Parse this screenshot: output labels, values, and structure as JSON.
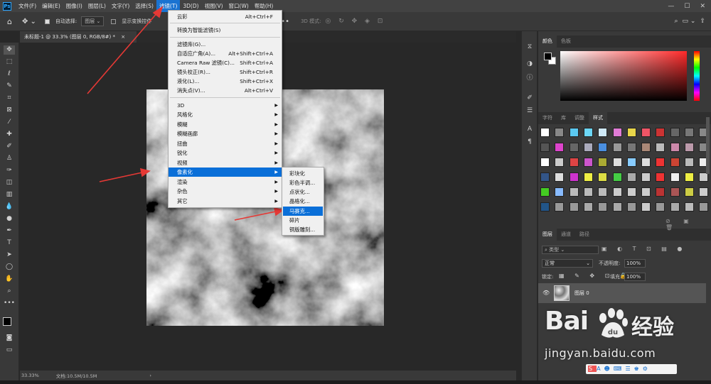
{
  "menubar": {
    "logo": "Ps",
    "items": [
      "文件(F)",
      "编辑(E)",
      "图像(I)",
      "图层(L)",
      "文字(Y)",
      "选择(S)",
      "滤镜(T)",
      "3D(D)",
      "视图(V)",
      "窗口(W)",
      "帮助(H)"
    ],
    "active_index": 6,
    "window_controls": [
      "—",
      "☐",
      "✕"
    ]
  },
  "options_bar": {
    "auto_select_label": "自动选择:",
    "auto_select_value": "图层",
    "show_transform_label": "显示变换控件",
    "mode_3d_label": "3D 模式:"
  },
  "document": {
    "tab_title": "未标题-1 @ 33.3% (图层 0, RGB/8#) *",
    "tab_close": "×"
  },
  "statusbar": {
    "zoom": "33.33%",
    "doc_info": "文档:10.5M/10.5M",
    "arrow": "›"
  },
  "filter_menu": {
    "top_items": [
      {
        "label": "云彩",
        "shortcut": "Alt+Ctrl+F"
      },
      {
        "label": "转换为智能滤镜(S)",
        "shortcut": ""
      },
      {
        "label": "滤镜库(G)...",
        "shortcut": ""
      },
      {
        "label": "自适应广角(A)...",
        "shortcut": "Alt+Shift+Ctrl+A"
      },
      {
        "label": "Camera Raw 滤镜(C)...",
        "shortcut": "Shift+Ctrl+A"
      },
      {
        "label": "镜头校正(R)...",
        "shortcut": "Shift+Ctrl+R"
      },
      {
        "label": "液化(L)...",
        "shortcut": "Shift+Ctrl+X"
      },
      {
        "label": "消失点(V)...",
        "shortcut": "Alt+Ctrl+V"
      }
    ],
    "submenus": [
      "3D",
      "风格化",
      "模糊",
      "模糊画廊",
      "扭曲",
      "锐化",
      "视频",
      "像素化",
      "渲染",
      "杂色",
      "其它"
    ],
    "highlighted_submenu": "像素化"
  },
  "pixelate_menu": {
    "items": [
      "彩块化",
      "彩色半调...",
      "点状化...",
      "晶格化...",
      "马赛克...",
      "碎片",
      "铜版雕刻..."
    ],
    "highlighted": "马赛克..."
  },
  "panels": {
    "color_tabs": [
      "颜色",
      "色板"
    ],
    "style_tabs": [
      "字符",
      "库",
      "调整",
      "样式"
    ],
    "active_style_tab": "样式",
    "layers_tabs": [
      "图层",
      "通道",
      "路径"
    ],
    "filter_kind": "类型",
    "blend_mode": "正常",
    "opacity_label": "不透明度:",
    "opacity_value": "100%",
    "lock_label": "锁定:",
    "fill_label": "填充:",
    "fill_value": "100%",
    "layer_name": "图层 0"
  },
  "watermark": {
    "brand_left": "Bai",
    "brand_right": "经验",
    "url": "jingyan.baidu.com"
  },
  "colors": {
    "accent": "#1a73d1",
    "arrow_red": "#e53935",
    "menu_bg": "#f0f0f0",
    "ui_dark": "#393939"
  }
}
